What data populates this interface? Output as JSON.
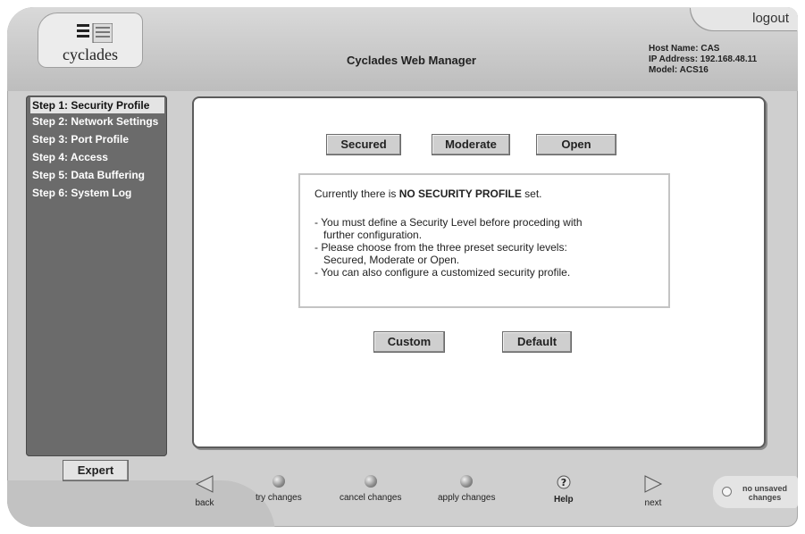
{
  "header": {
    "logo_text": "cyclades",
    "logout_label": "logout",
    "app_title": "Cyclades Web Manager",
    "host_name_line": "Host Name: CAS",
    "ip_address_line": "IP Address: 192.168.48.11",
    "model_line": "Model: ACS16"
  },
  "sidebar": {
    "steps": [
      {
        "label": "Step 1: Security Profile",
        "active": true
      },
      {
        "label": "Step 2: Network Settings"
      },
      {
        "label": "Step 3: Port Profile"
      },
      {
        "label": "Step 4: Access"
      },
      {
        "label": "Step 5: Data Buffering"
      },
      {
        "label": "Step 6: System Log"
      }
    ],
    "expert_label": "Expert"
  },
  "main": {
    "profile_buttons": [
      "Secured",
      "Moderate",
      "Open"
    ],
    "message": {
      "line1_prefix": "Currently there is ",
      "line1_bold": "NO SECURITY PROFILE",
      "line1_suffix": " set.",
      "bullets": [
        "- You must define a Security Level before proceding with",
        "  further configuration.",
        "- Please choose from the three preset security levels:",
        "  Secured, Moderate or Open.",
        "- You can also configure a customized security profile."
      ]
    },
    "action_buttons": [
      "Custom",
      "Default"
    ]
  },
  "bottom_nav": {
    "back": "back",
    "try_changes": "try changes",
    "cancel_changes": "cancel changes",
    "apply_changes": "apply changes",
    "help": "Help",
    "next": "next",
    "unsaved_line1": "no unsaved",
    "unsaved_line2": "changes"
  },
  "icons": {
    "logo": "cyclades-logo-mark",
    "back": "back-arrow-icon",
    "next": "next-arrow-icon",
    "help": "help-question-icon",
    "action_dots": "round-button-icon",
    "status": "unsaved-status-dot-icon"
  }
}
